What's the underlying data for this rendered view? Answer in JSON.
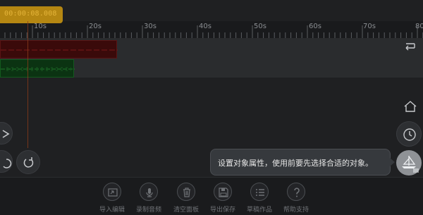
{
  "time_display": "00:00:08.008",
  "ruler": {
    "labels": [
      "10s",
      "20s",
      "30s",
      "40s",
      "50s",
      "60s",
      "70s",
      "80"
    ]
  },
  "tooltip": {
    "text": "设置对象属性，使用前要先选择合适的对象。"
  },
  "toolbar": {
    "items": [
      {
        "label": "导入编辑",
        "icon": "import-icon"
      },
      {
        "label": "录制音频",
        "icon": "microphone-icon"
      },
      {
        "label": "清空面板",
        "icon": "trash-icon"
      },
      {
        "label": "导出保存",
        "icon": "save-icon"
      },
      {
        "label": "草稿作品",
        "icon": "list-icon"
      },
      {
        "label": "帮助支持",
        "icon": "help-icon"
      }
    ]
  },
  "colors": {
    "time_badge": "#b58712",
    "track_red": "#3a0a0a",
    "track_green": "#0b3312",
    "background": "#1f2022"
  }
}
